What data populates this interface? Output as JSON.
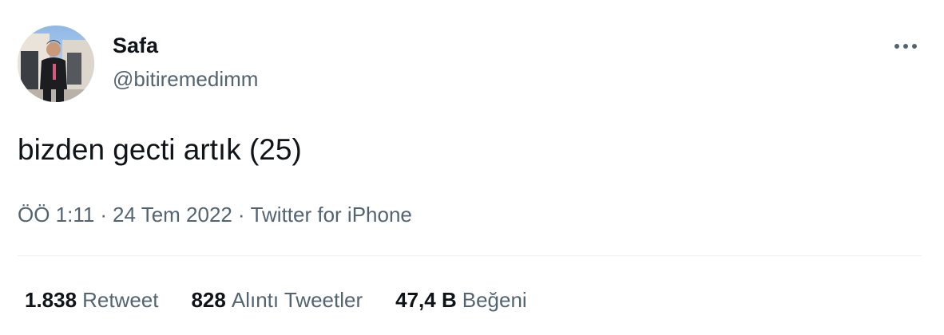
{
  "user": {
    "display_name": "Safa",
    "handle": "@bitiremedimm"
  },
  "tweet": {
    "text": "bizden gecti artık (25)"
  },
  "meta": {
    "time": "ÖÖ 1:11",
    "separator": "·",
    "date": "24 Tem 2022",
    "source": "Twitter for iPhone"
  },
  "stats": {
    "retweets": {
      "count": "1.838",
      "label": "Retweet"
    },
    "quotes": {
      "count": "828",
      "label": "Alıntı Tweetler"
    },
    "likes": {
      "count": "47,4 B",
      "label": "Beğeni"
    }
  },
  "icons": {
    "more": "more-horizontal-icon"
  },
  "colors": {
    "primary_text": "#0f1419",
    "secondary_text": "#536471",
    "divider": "#eff3f4",
    "background": "#ffffff"
  }
}
